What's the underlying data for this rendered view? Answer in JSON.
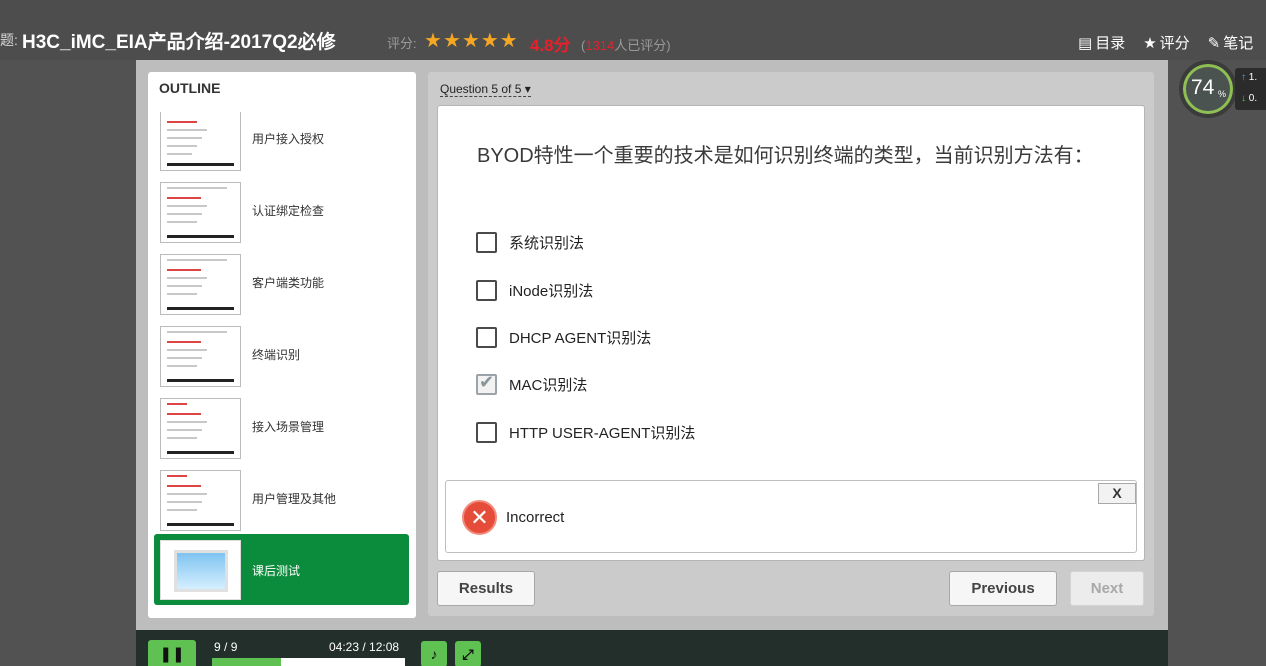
{
  "header": {
    "title_prefix": "题:",
    "course_title": "H3C_iMC_EIA产品介绍-2017Q2必修",
    "rating_label": "评分:",
    "stars": 5,
    "score": "4.8分",
    "count_open": "(",
    "rating_count": "1314",
    "count_close": "人已评分)",
    "actions": [
      {
        "icon": "list-icon",
        "label": "目录"
      },
      {
        "icon": "star-icon",
        "label": "评分"
      },
      {
        "icon": "pencil-icon",
        "label": "笔记"
      }
    ]
  },
  "outline": {
    "title": "OUTLINE",
    "slides": [
      {
        "label": "用户接入授权"
      },
      {
        "label": "认证绑定检查"
      },
      {
        "label": "客户端类功能"
      },
      {
        "label": "终端识别"
      },
      {
        "label": "接入场景管理"
      },
      {
        "label": "用户管理及其他"
      },
      {
        "label": "课后测试",
        "active": true
      }
    ]
  },
  "quiz": {
    "counter": "Question 5 of 5",
    "question": "BYOD特性一个重要的技术是如何识别终端的类型，当前识别方法有：",
    "choices": [
      {
        "label": "系统识别法",
        "checked": false
      },
      {
        "label": "iNode识别法",
        "checked": false
      },
      {
        "label": "DHCP AGENT识别法",
        "checked": false
      },
      {
        "label": "MAC识别法",
        "checked": true
      },
      {
        "label": "HTTP USER-AGENT识别法",
        "checked": false
      }
    ],
    "feedback": {
      "close_label": "X",
      "status": "Incorrect"
    },
    "buttons": {
      "results": "Results",
      "previous": "Previous",
      "next": "Next"
    }
  },
  "controls": {
    "slide_current": "9",
    "slide_total": "9",
    "time_current": "04:23",
    "time_total": "12:08",
    "progress_fraction": 0.36
  },
  "speed_widget": {
    "percent": "74",
    "percent_sign": "%",
    "upload": "1.",
    "download": "0."
  },
  "colors": {
    "accent_green": "#0b8c3c",
    "control_green": "#5ec151",
    "score_red": "#e8202a",
    "star_gold": "#f5a623",
    "incorrect_red": "#e54d3a"
  }
}
